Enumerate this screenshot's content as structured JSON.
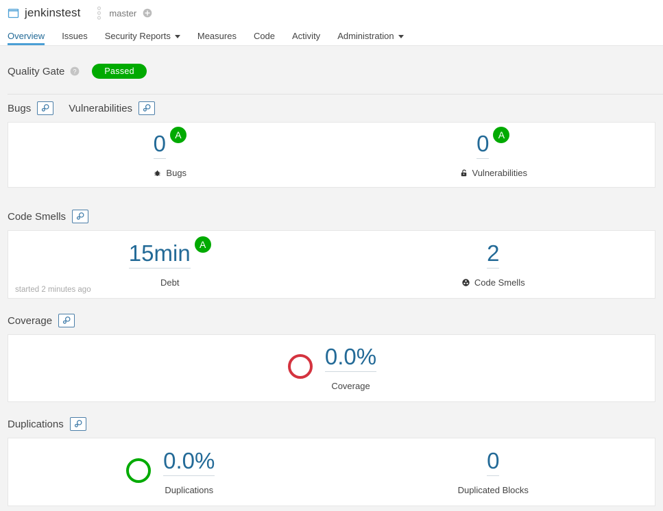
{
  "header": {
    "project_icon": "project-box-icon",
    "project_name": "jenkinstest",
    "branch_icon": "branch-icon",
    "branch_name": "master",
    "branch_add_icon": "plus-circle-icon"
  },
  "nav": {
    "items": [
      {
        "label": "Overview",
        "active": true,
        "dropdown": false
      },
      {
        "label": "Issues",
        "active": false,
        "dropdown": false
      },
      {
        "label": "Security Reports",
        "active": false,
        "dropdown": true
      },
      {
        "label": "Measures",
        "active": false,
        "dropdown": false
      },
      {
        "label": "Code",
        "active": false,
        "dropdown": false
      },
      {
        "label": "Activity",
        "active": false,
        "dropdown": false
      },
      {
        "label": "Administration",
        "active": false,
        "dropdown": true
      }
    ]
  },
  "quality_gate": {
    "title": "Quality Gate",
    "help_icon": "help-circle-icon",
    "status": "Passed",
    "status_color": "#00aa00"
  },
  "sections": {
    "reliability": {
      "title": "Bugs",
      "title_link_icon": "link-pin-icon",
      "title2": "Vulnerabilities",
      "title2_link_icon": "link-pin-icon",
      "bugs": {
        "value": "0",
        "rating": "A",
        "rating_color": "#00aa00",
        "label": "Bugs",
        "icon": "bug-icon"
      },
      "vulnerabilities": {
        "value": "0",
        "rating": "A",
        "rating_color": "#00aa00",
        "label": "Vulnerabilities",
        "icon": "unlocked-padlock-icon"
      }
    },
    "maintainability": {
      "title": "Code Smells",
      "title_link_icon": "link-pin-icon",
      "debt": {
        "value": "15min",
        "rating": "A",
        "rating_color": "#00aa00",
        "label": "Debt",
        "started": "started 2 minutes ago"
      },
      "code_smells": {
        "value": "2",
        "label": "Code Smells",
        "icon": "code-smell-icon"
      }
    },
    "coverage": {
      "title": "Coverage",
      "title_link_icon": "link-pin-icon",
      "value": "0.0%",
      "label": "Coverage",
      "ring_color": "#d4333f",
      "ring_fill": 0
    },
    "duplications": {
      "title": "Duplications",
      "title_link_icon": "link-pin-icon",
      "percent": {
        "value": "0.0%",
        "label": "Duplications",
        "ring_color": "#00aa00",
        "ring_fill": 0
      },
      "blocks": {
        "value": "0",
        "label": "Duplicated Blocks"
      }
    }
  }
}
